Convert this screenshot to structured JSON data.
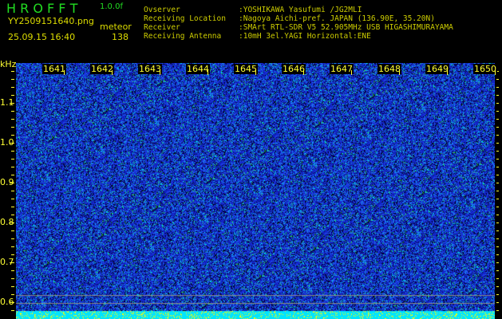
{
  "header": {
    "app_title": "H R O F F T",
    "version": "1.0.0f",
    "filename": "YY2509151640.png",
    "mode": "meteor",
    "datetime": "25.09.15 16:40",
    "count": "138"
  },
  "station_info": [
    {
      "label": "Ovserver",
      "value": ":YOSHIKAWA Yasufumi /JG2MLI"
    },
    {
      "label": "Receiving Location",
      "value": ":Nagoya Aichi-pref. JAPAN (136.90E, 35.20N)"
    },
    {
      "label": "Receiver",
      "value": ":SMArt RTL-SDR V5 52.905MHz USB HIGASHIMURAYAMA"
    },
    {
      "label": "Receiving Antenna",
      "value": ":10mH 3el.YAGI Horizontal:ENE"
    }
  ],
  "spectrogram": {
    "y_unit": "kHz",
    "y_ticks": [
      "1.1",
      "1.0",
      "0.9",
      "0.8",
      "0.7",
      "0.6"
    ],
    "time_labels": [
      "1641",
      "1642",
      "1643",
      "1644",
      "1645",
      "1646",
      "1647",
      "1648",
      "1649",
      "1650"
    ],
    "colors": {
      "background_noise": "#1020c0",
      "strong": "#00ffff",
      "bottom_bar": "#00e5ff",
      "bottom_peaks": "#ffff00",
      "grid_line": "#888888"
    }
  }
}
